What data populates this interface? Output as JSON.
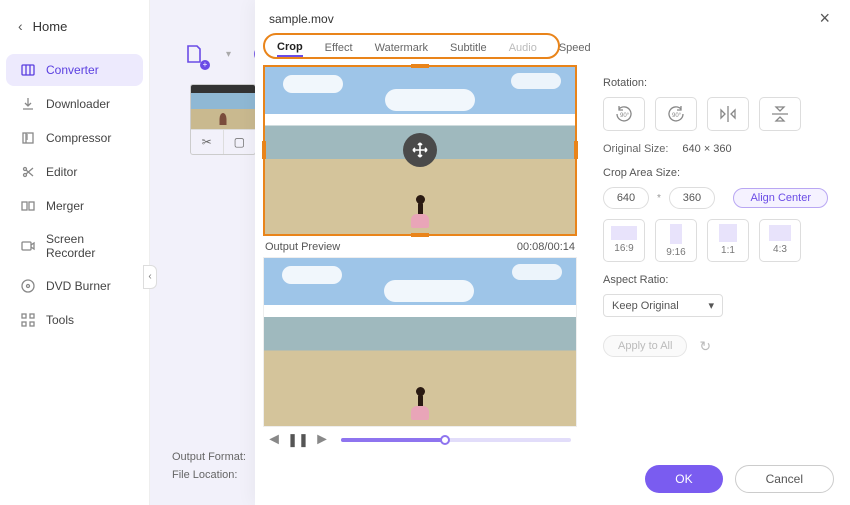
{
  "home_label": "Home",
  "sidebar": {
    "items": [
      {
        "label": "Converter"
      },
      {
        "label": "Downloader"
      },
      {
        "label": "Compressor"
      },
      {
        "label": "Editor"
      },
      {
        "label": "Merger"
      },
      {
        "label": "Screen Recorder"
      },
      {
        "label": "DVD Burner"
      },
      {
        "label": "Tools"
      }
    ]
  },
  "bottom": {
    "output_format_label": "Output Format:",
    "file_location_label": "File Location:"
  },
  "modal": {
    "title": "sample.mov",
    "tabs": [
      "Crop",
      "Effect",
      "Watermark",
      "Subtitle",
      "Audio",
      "Speed"
    ],
    "output_preview_label": "Output Preview",
    "time": "00:08/00:14",
    "rotation_label": "Rotation:",
    "original_size_label": "Original Size:",
    "original_size_value": "640 × 360",
    "crop_area_label": "Crop Area Size:",
    "crop_w": "640",
    "crop_h": "360",
    "align_center": "Align Center",
    "ratios": [
      "16:9",
      "9:16",
      "1:1",
      "4:3"
    ],
    "aspect_label": "Aspect Ratio:",
    "aspect_value": "Keep Original",
    "apply_all": "Apply to All",
    "ok": "OK",
    "cancel": "Cancel"
  }
}
